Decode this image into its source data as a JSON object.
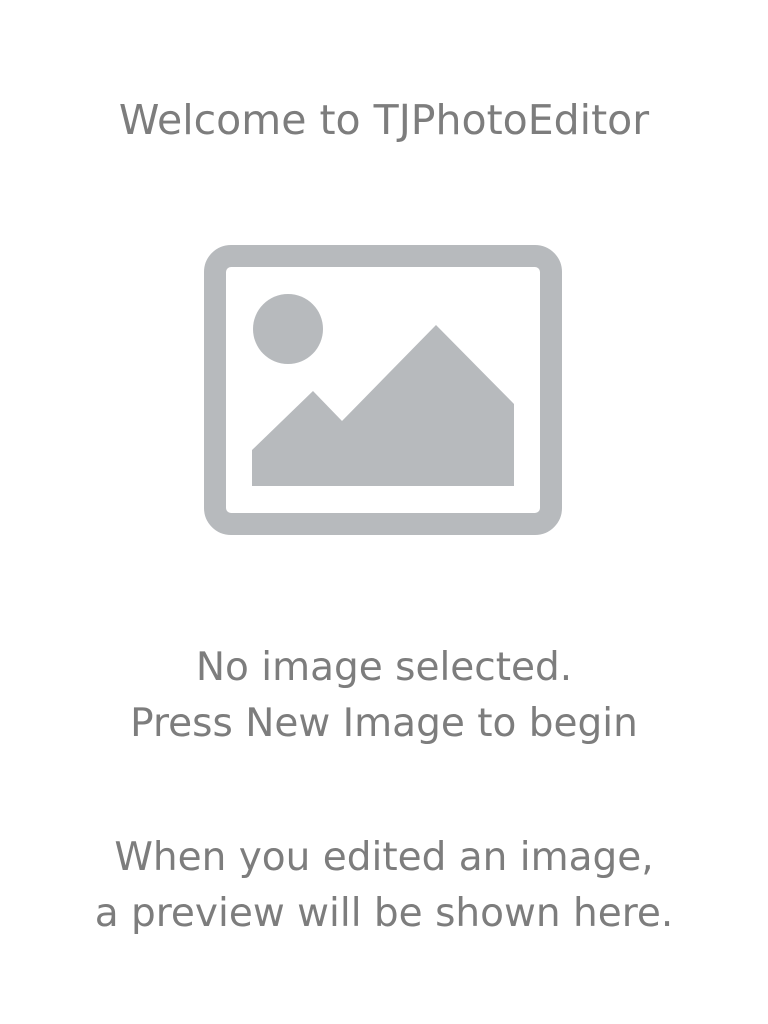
{
  "header": {
    "title": "Welcome to TJPhotoEditor"
  },
  "placeholder": {
    "icon": "image-placeholder-icon",
    "color": "#b7babd"
  },
  "status": {
    "line1": "No image selected.",
    "line2": "Press New Image to begin"
  },
  "preview_hint": {
    "line1": "When you edited an image,",
    "line2": "a preview will be shown here."
  }
}
